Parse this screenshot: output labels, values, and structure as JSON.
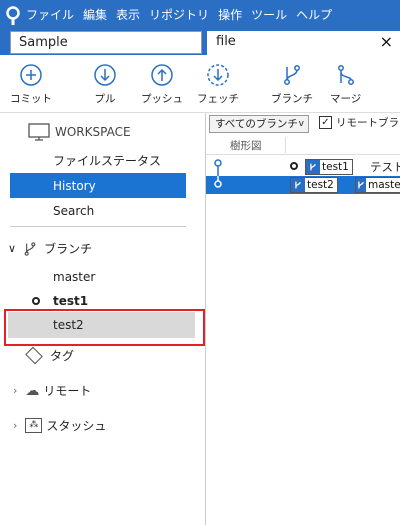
{
  "menu": [
    "ファイル",
    "編集",
    "表示",
    "リポジトリ",
    "操作",
    "ツール",
    "ヘルプ"
  ],
  "tabs": {
    "repo_tab": "Sample",
    "search_value": "file",
    "close": "×"
  },
  "toolbar": {
    "commit": "コミット",
    "pull": "プル",
    "push": "プッシュ",
    "fetch": "フェッチ",
    "branch": "ブランチ",
    "merge": "マージ"
  },
  "sidebar": {
    "workspace": "WORKSPACE",
    "file_status": "ファイルステータス",
    "history": "History",
    "search": "Search",
    "branches_header": "ブランチ",
    "branches": [
      "master",
      "test1",
      "test2"
    ],
    "tags": "タグ",
    "remote": "リモート",
    "stash": "スタッシュ"
  },
  "main": {
    "branch_filter": "すべてのブランチ",
    "remote_branches_label": "リモートブランチ",
    "graph_header": "樹形図",
    "commits": [
      {
        "branch": "test1",
        "message": "テスト"
      },
      {
        "branch": "test2",
        "branch2": "maste"
      }
    ]
  },
  "colors": {
    "accent": "#1b73d2",
    "menubar": "#2b6fc4",
    "highlight": "#e0212a"
  }
}
